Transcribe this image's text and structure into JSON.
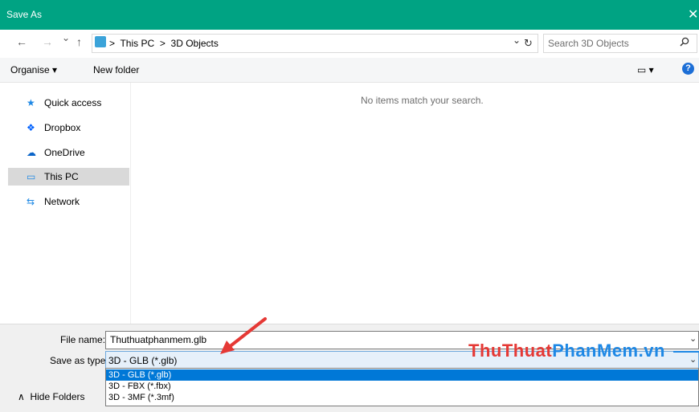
{
  "window": {
    "title": "Save As",
    "close_glyph": "✕"
  },
  "navbar": {
    "back_glyph": "←",
    "forward_glyph": "→",
    "recent_glyph": "⌄",
    "up_glyph": "↑",
    "breadcrumb": [
      "This PC",
      "3D Objects"
    ],
    "separator": ">",
    "dropdown_glyph": "⌄",
    "refresh_glyph": "↻"
  },
  "search": {
    "placeholder": "Search 3D Objects",
    "icon": "search-icon"
  },
  "toolbar": {
    "organise_label": "Organise ▾",
    "new_folder_label": "New folder",
    "view_glyph": "▭ ▾",
    "help_glyph": "?"
  },
  "sidebar": {
    "items": [
      {
        "label": "Quick access",
        "icon": "star-icon",
        "glyph": "★",
        "color": "#1e88e5"
      },
      {
        "label": "Dropbox",
        "icon": "dropbox-icon",
        "glyph": "❖",
        "color": "#0061fe"
      },
      {
        "label": "OneDrive",
        "icon": "cloud-icon",
        "glyph": "☁",
        "color": "#0a64c8"
      },
      {
        "label": "This PC",
        "icon": "computer-icon",
        "glyph": "▭",
        "color": "#1e88e5"
      },
      {
        "label": "Network",
        "icon": "network-icon",
        "glyph": "⇆",
        "color": "#1e88e5"
      }
    ]
  },
  "main": {
    "empty_message": "No items match your search."
  },
  "form": {
    "file_name_label": "File name:",
    "file_name_value": "Thuthuatphanmem.glb",
    "save_as_type_label": "Save as type:",
    "save_as_type_value": "3D - GLB (*.glb)",
    "options": [
      "3D - GLB (*.glb)",
      "3D - FBX (*.fbx)",
      "3D - 3MF (*.3mf)"
    ]
  },
  "footer": {
    "hide_folders_label": "Hide Folders",
    "hide_folders_glyph": "∧"
  },
  "watermark": {
    "part1": "ThuThuat",
    "part2": "PhanMem.vn"
  },
  "colors": {
    "titlebar": "#00a383",
    "accent": "#0078d7",
    "annotation_arrow": "#e53935"
  }
}
